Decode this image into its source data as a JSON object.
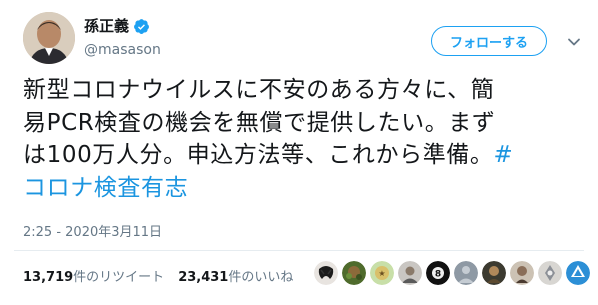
{
  "user": {
    "display_name": "孫正義",
    "username": "@masason",
    "verified_icon": "verified-badge-icon"
  },
  "actions": {
    "follow_label": "フォローする",
    "more_icon": "chevron-down-icon"
  },
  "tweet": {
    "line1": "新型コロナウイルスに不安のある方々に、簡",
    "line2": "易PCR検査の機会を無償で提供したい。まず",
    "line3": "は100万人分。申込方法等、これから準備。",
    "hashtag_mark": "#",
    "hashtag_text": "コロナ検査有志",
    "timestamp": "2:25 - 2020年3月11日"
  },
  "stats": {
    "retweets_count": "13,719",
    "retweets_label": "件のリツイート",
    "likes_count": "23,431",
    "likes_label": "件のいいね"
  },
  "colors": {
    "accent": "#1da1f2",
    "hashtag": "#1b95e0",
    "muted": "#657786"
  }
}
